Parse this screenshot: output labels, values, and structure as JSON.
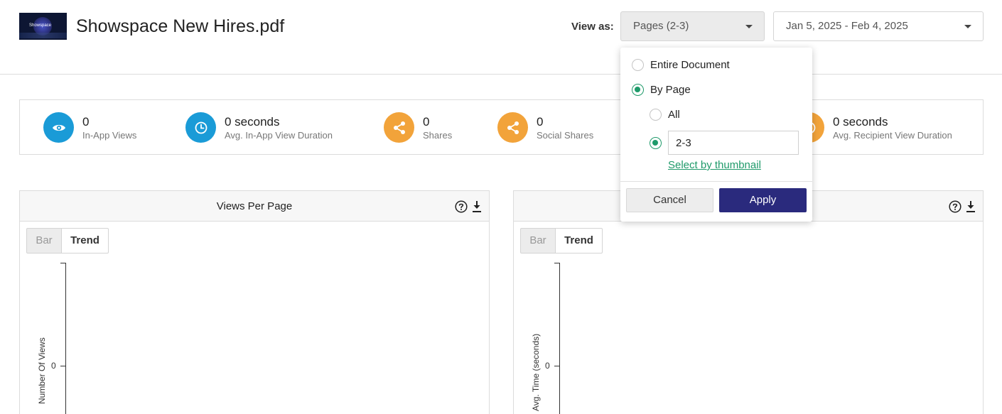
{
  "header": {
    "thumbnail_text": "Showspace",
    "document_title": "Showspace New Hires.pdf",
    "view_as_label": "View as:",
    "view_select_value": "Pages (2-3)",
    "date_range_value": "Jan 5, 2025 - Feb 4, 2025"
  },
  "stats": [
    {
      "value": "0",
      "label": "In-App Views",
      "icon": "eye-icon",
      "color": "#1a9bd7"
    },
    {
      "value": "0 seconds",
      "label": "Avg. In-App View Duration",
      "icon": "clock-icon",
      "color": "#1a9bd7"
    },
    {
      "value": "0",
      "label": "Shares",
      "icon": "share-icon",
      "color": "#f2a33a"
    },
    {
      "value": "0",
      "label": "Social Shares",
      "icon": "share-icon",
      "color": "#f2a33a"
    },
    {
      "value": "0 seconds",
      "label": "Avg. Recipient View Duration",
      "icon": "clock-icon",
      "color": "#f2a33a"
    }
  ],
  "panels": {
    "left": {
      "title": "Views Per Page",
      "bar_label": "Bar",
      "trend_label": "Trend",
      "y_tick": "0",
      "y_axis_label": "Number Of Views"
    },
    "right": {
      "title": "",
      "bar_label": "Bar",
      "trend_label": "Trend",
      "y_tick": "0",
      "y_axis_label": "Avg. Time (seconds)"
    }
  },
  "dropdown": {
    "option_entire_document": "Entire Document",
    "option_by_page": "By Page",
    "option_all": "All",
    "page_range_value": "2-3",
    "select_by_thumbnail": "Select by thumbnail",
    "cancel_label": "Cancel",
    "apply_label": "Apply",
    "selected_mode": "By Page",
    "selected_page_option": "range"
  },
  "colors": {
    "accent_green": "#1f9a6a",
    "apply_button": "#2a2a7d",
    "stat_blue": "#1a9bd7",
    "stat_orange": "#f2a33a"
  }
}
